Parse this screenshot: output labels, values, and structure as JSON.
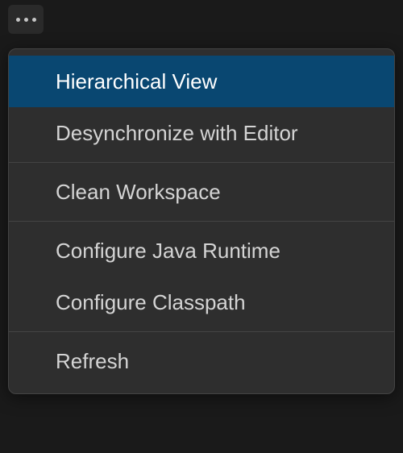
{
  "toolbar": {
    "more_button": "more-options"
  },
  "menu": {
    "items": [
      {
        "label": "Hierarchical View",
        "highlighted": true
      },
      {
        "label": "Desynchronize with Editor",
        "highlighted": false
      },
      {
        "label": "Clean Workspace",
        "highlighted": false
      },
      {
        "label": "Configure Java Runtime",
        "highlighted": false
      },
      {
        "label": "Configure Classpath",
        "highlighted": false
      },
      {
        "label": "Refresh",
        "highlighted": false
      }
    ]
  }
}
